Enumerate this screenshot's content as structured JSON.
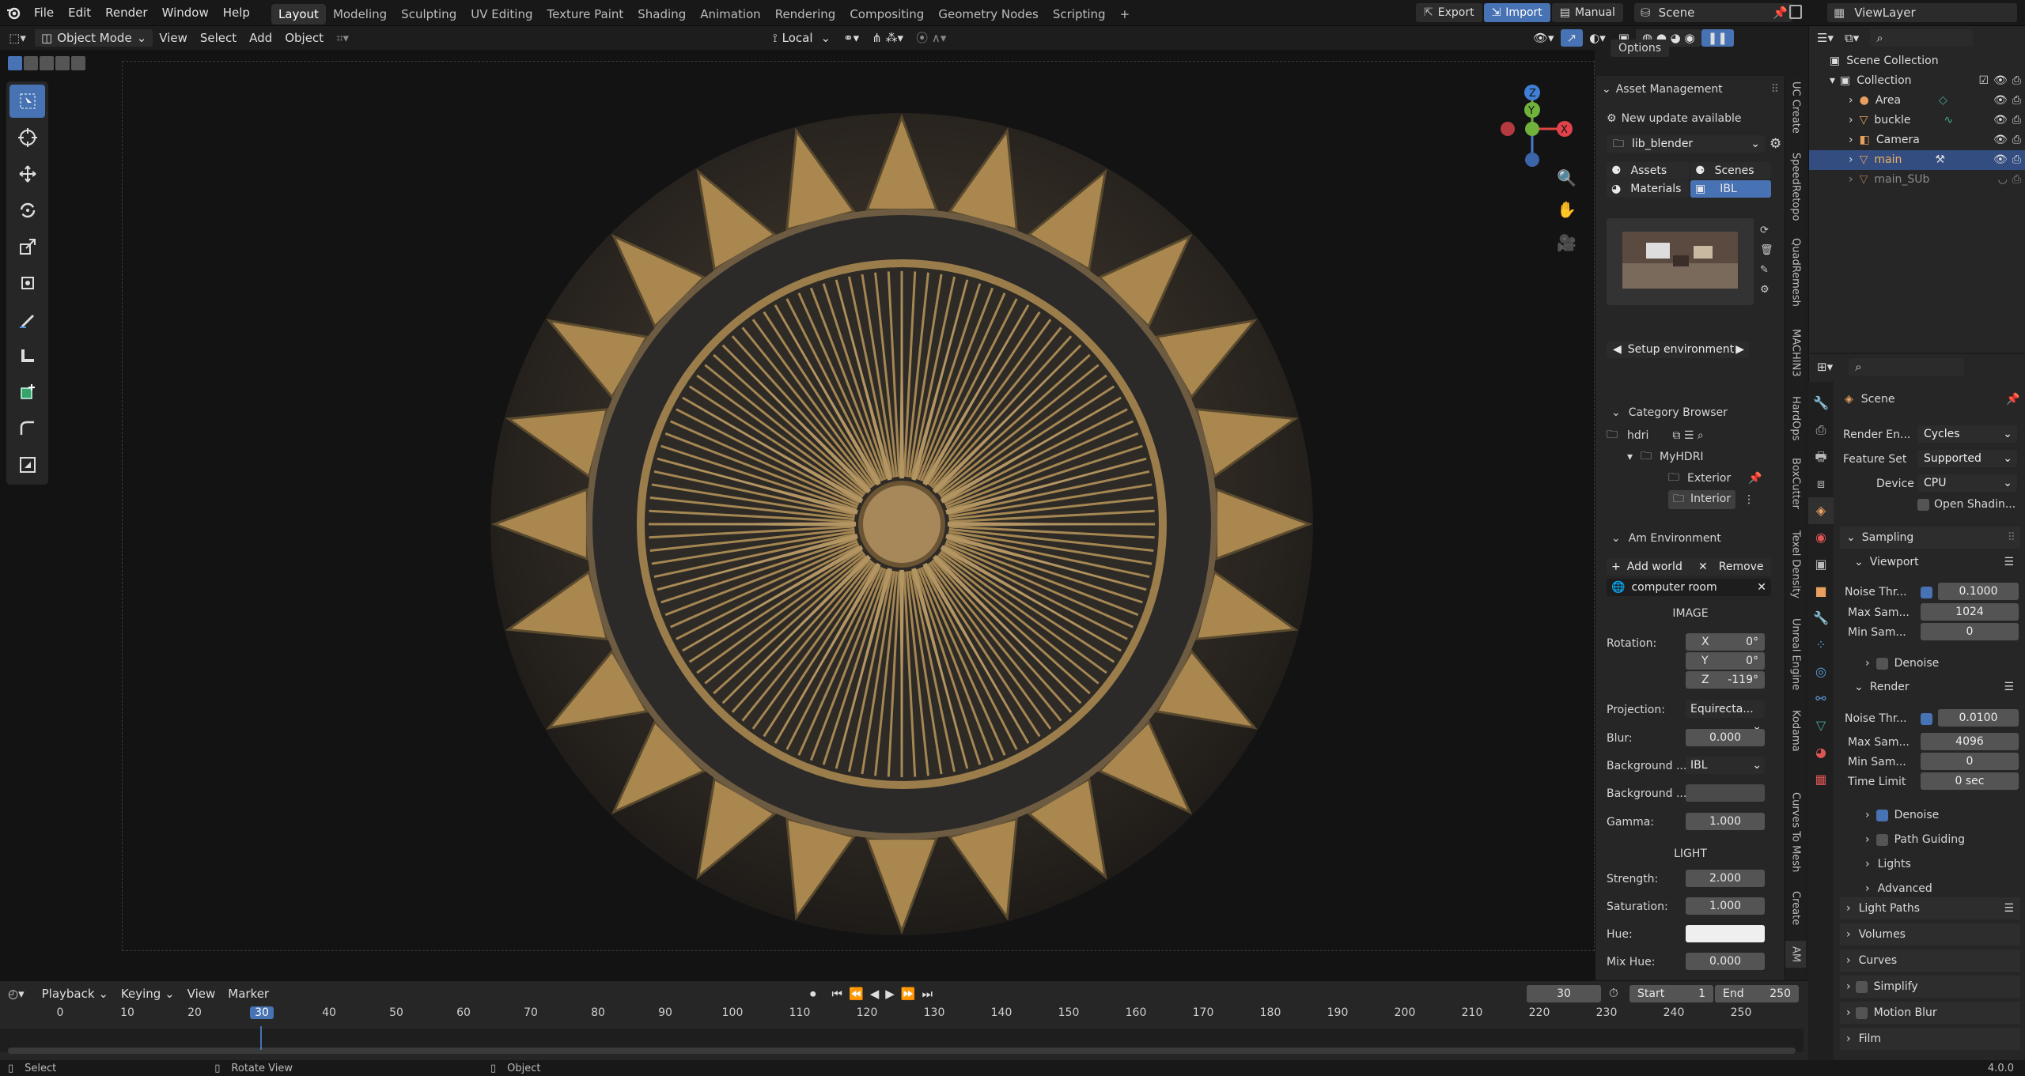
{
  "topbar": {
    "menus": [
      "File",
      "Edit",
      "Render",
      "Window",
      "Help"
    ],
    "workspaces": [
      "Layout",
      "Modeling",
      "Sculpting",
      "UV Editing",
      "Texture Paint",
      "Shading",
      "Animation",
      "Rendering",
      "Compositing",
      "Geometry Nodes",
      "Scripting"
    ],
    "add_tab": "+",
    "export_label": "Export",
    "import_label": "Import",
    "manual_label": "Manual",
    "scene_name": "Scene",
    "view_layer": "ViewLayer"
  },
  "viewport_header": {
    "mode": "Object Mode",
    "menus": [
      "View",
      "Select",
      "Add",
      "Object"
    ],
    "orientation": "Local",
    "options": "Options"
  },
  "asset_panel": {
    "title": "Asset Management",
    "update": "New update available",
    "library": "lib_blender",
    "tab_assets": "Assets",
    "tab_scenes": "Scenes",
    "tab_materials": "Materials",
    "tab_ibl": "IBL",
    "setup": "Setup environment",
    "category_title": "Category Browser",
    "cat_root": "hdri",
    "cat_myhdri": "MyHDRI",
    "cat_exterior": "Exterior",
    "cat_interior": "Interior",
    "env_title": "Am Environment",
    "add_world": "Add world",
    "remove": "Remove",
    "env_name": "computer room",
    "image_heading": "IMAGE",
    "rotation_label": "Rotation:",
    "rot_x_label": "X",
    "rot_x": "0°",
    "rot_y_label": "Y",
    "rot_y": "0°",
    "rot_z_label": "Z",
    "rot_z": "-119°",
    "projection_label": "Projection:",
    "projection": "Equirecta...",
    "blur_label": "Blur:",
    "blur": "0.000",
    "bg1_label": "Background ...",
    "bg1": "IBL",
    "bg2_label": "Background ...",
    "gamma_label": "Gamma:",
    "gamma": "1.000",
    "light_heading": "LIGHT",
    "strength_label": "Strength:",
    "strength": "2.000",
    "saturation_label": "Saturation:",
    "saturation": "1.000",
    "hue_label": "Hue:",
    "mixhue_label": "Mix Hue:",
    "mixhue": "0.000"
  },
  "side_tabs": [
    "UC Create",
    "SpeedRetopo",
    "QuadRemesh",
    "MACHIN3",
    "HardOps",
    "BoxCutter",
    "Texel Density",
    "Unreal Engine",
    "Kodama",
    "Curves To Mesh",
    "Create",
    "AM"
  ],
  "outliner": {
    "root": "Scene Collection",
    "collection": "Collection",
    "items": [
      "Area",
      "buckle",
      "Camera",
      "main",
      "main_SUb"
    ]
  },
  "properties": {
    "scene": "Scene",
    "render_engine_label": "Render En...",
    "render_engine": "Cycles",
    "feature_set_label": "Feature Set",
    "feature_set": "Supported",
    "device_label": "Device",
    "device": "CPU",
    "open_shading": "Open Shadin...",
    "sampling": "Sampling",
    "viewport": "Viewport",
    "noise_thr_label": "Noise Thr...",
    "vp_noise": "0.1000",
    "max_sam_label": "Max Sam...",
    "vp_max": "1024",
    "min_sam_label": "Min Sam...",
    "vp_min": "0",
    "denoise": "Denoise",
    "render": "Render",
    "r_noise": "0.0100",
    "r_max": "4096",
    "r_min": "0",
    "time_limit_label": "Time Limit",
    "time_limit": "0 sec",
    "path_guiding": "Path Guiding",
    "lights": "Lights",
    "advanced": "Advanced",
    "light_paths": "Light Paths",
    "volumes": "Volumes",
    "curves": "Curves",
    "simplify": "Simplify",
    "motion_blur": "Motion Blur",
    "film": "Film"
  },
  "timeline": {
    "menus": [
      "Playback",
      "Keying",
      "View",
      "Marker"
    ],
    "current_frame": "30",
    "start_label": "Start",
    "start": "1",
    "end_label": "End",
    "end": "250",
    "ticks": [
      "0",
      "10",
      "20",
      "30",
      "40",
      "50",
      "60",
      "70",
      "80",
      "90",
      "100",
      "110",
      "120",
      "130",
      "140",
      "150",
      "160",
      "170",
      "180",
      "190",
      "200",
      "210",
      "220",
      "230",
      "240",
      "250"
    ]
  },
  "statusbar": {
    "select": "Select",
    "rotate": "Rotate View",
    "object": "Object",
    "version": "4.0.0"
  },
  "colors": {
    "accent": "#4772b3",
    "shield_gold": "#b8965c",
    "panel": "#262626"
  }
}
